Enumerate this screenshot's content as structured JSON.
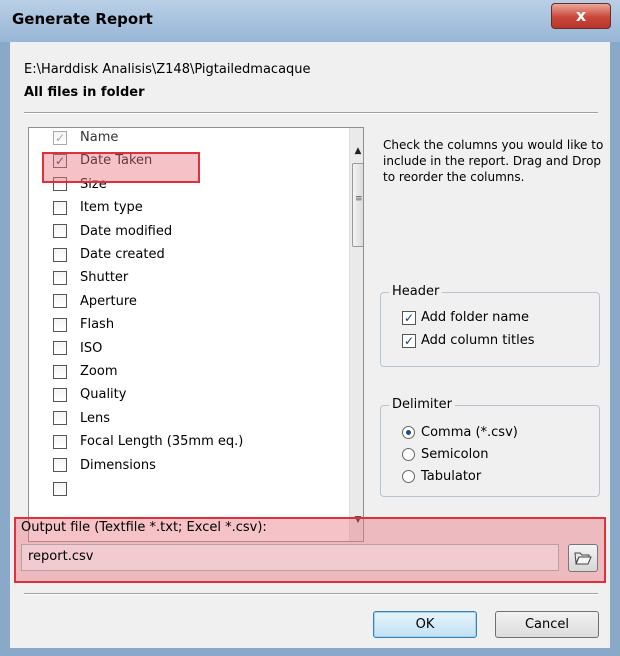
{
  "window": {
    "title": "Generate Report",
    "close_glyph": "x"
  },
  "source": {
    "path": "E:\\Harddisk Analisis\\Z148\\Pigtailedmacaque",
    "scope": "All files in folder"
  },
  "columns": [
    {
      "label": "Name",
      "checked": true,
      "disabled": true
    },
    {
      "label": "Date Taken",
      "checked": true,
      "disabled": false
    },
    {
      "label": "Size",
      "checked": false,
      "disabled": false
    },
    {
      "label": "Item type",
      "checked": false,
      "disabled": false
    },
    {
      "label": "Date modified",
      "checked": false,
      "disabled": false
    },
    {
      "label": "Date created",
      "checked": false,
      "disabled": false
    },
    {
      "label": "Shutter",
      "checked": false,
      "disabled": false
    },
    {
      "label": "Aperture",
      "checked": false,
      "disabled": false
    },
    {
      "label": "Flash",
      "checked": false,
      "disabled": false
    },
    {
      "label": "ISO",
      "checked": false,
      "disabled": false
    },
    {
      "label": "Zoom",
      "checked": false,
      "disabled": false
    },
    {
      "label": "Quality",
      "checked": false,
      "disabled": false
    },
    {
      "label": "Lens",
      "checked": false,
      "disabled": false
    },
    {
      "label": "Focal Length (35mm eq.)",
      "checked": false,
      "disabled": false
    },
    {
      "label": "Dimensions",
      "checked": false,
      "disabled": false
    },
    {
      "label": "",
      "checked": false,
      "disabled": false
    }
  ],
  "hint_text": "Check the columns you would like to include in the report. Drag and Drop to reorder the columns.",
  "header_group": {
    "title": "Header",
    "add_folder_name": {
      "label": "Add folder name",
      "checked": true
    },
    "add_column_titles": {
      "label": "Add column titles",
      "checked": true
    }
  },
  "delimiter_group": {
    "title": "Delimiter",
    "options": [
      {
        "label": "Comma (*.csv)",
        "selected": true
      },
      {
        "label": "Semicolon",
        "selected": false
      },
      {
        "label": "Tabulator",
        "selected": false
      }
    ]
  },
  "output": {
    "label": "Output file (Textfile *.txt; Excel *.csv):",
    "value": "report.csv",
    "browse_icon": "folder-open-icon"
  },
  "buttons": {
    "ok": "OK",
    "cancel": "Cancel"
  },
  "colors": {
    "highlight_border": "#e0303a",
    "highlight_fill": "#e6788273",
    "default_button": "#3c7fb1"
  }
}
